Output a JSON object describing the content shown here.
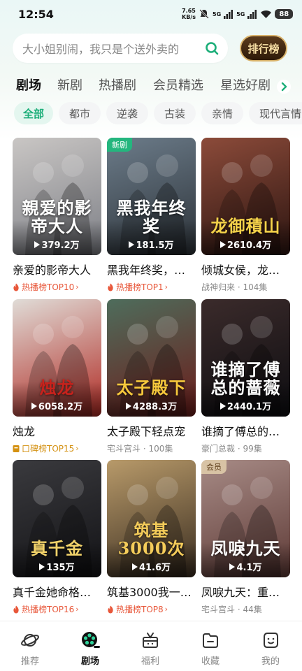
{
  "status_bar": {
    "time": "12:54",
    "speed_value": "7.65",
    "speed_unit": "KB/s",
    "network_1": "5G",
    "network_2": "5G",
    "battery": "88"
  },
  "search": {
    "placeholder": "大小姐别闹，我只是个送外卖的"
  },
  "rank_button": "排行榜",
  "tabs": [
    {
      "label": "剧场",
      "active": true
    },
    {
      "label": "新剧",
      "active": false
    },
    {
      "label": "热播剧",
      "active": false
    },
    {
      "label": "会员精选",
      "active": false
    },
    {
      "label": "星选好剧",
      "active": false
    }
  ],
  "filters": [
    {
      "label": "全部",
      "active": true
    },
    {
      "label": "都市",
      "active": false
    },
    {
      "label": "逆袭",
      "active": false
    },
    {
      "label": "古装",
      "active": false
    },
    {
      "label": "亲情",
      "active": false
    },
    {
      "label": "现代言情",
      "active": false
    }
  ],
  "dramas": [
    {
      "title": "亲爱的影帝大人",
      "views": "379.2万",
      "poster_text": "親爱的影帝大人",
      "sub_type": "rank",
      "sub": "热播榜TOP10",
      "badge": "",
      "colors": [
        "#c9c6c4",
        "#7d7f86"
      ],
      "text_color": "#ffffff"
    },
    {
      "title": "黑我年终奖，…",
      "views": "181.5万",
      "poster_text": "黑我年终奖",
      "sub_type": "rank",
      "sub": "热播榜TOP1",
      "badge": "新剧",
      "colors": [
        "#6c7c8a",
        "#2c3238"
      ],
      "text_color": "#ffffff"
    },
    {
      "title": "倾城女侯，龙…",
      "views": "2610.4万",
      "poster_text": "龙御積山",
      "sub_type": "meta",
      "sub": "战神归来 · 104集",
      "badge": "",
      "colors": [
        "#8c4b3a",
        "#2b1410"
      ],
      "text_color": "#f4d24a"
    },
    {
      "title": "烛龙",
      "views": "6058.2万",
      "poster_text": "烛龙",
      "sub_type": "rank-gold",
      "sub": "口碑榜TOP15",
      "badge": "",
      "colors": [
        "#e0dcd7",
        "#b02a23"
      ],
      "text_color": "#c8221c"
    },
    {
      "title": "太子殿下轻点宠",
      "views": "4288.3万",
      "poster_text": "太子殿下",
      "sub_type": "meta",
      "sub": "宅斗宫斗 · 100集",
      "badge": "",
      "colors": [
        "#4e6d5c",
        "#6b1c1a"
      ],
      "text_color": "#f6c83c"
    },
    {
      "title": "谁摘了傅总的…",
      "views": "2440.1万",
      "poster_text": "谁摘了傅总的蔷薇",
      "sub_type": "meta",
      "sub": "豪门总裁 · 99集",
      "badge": "",
      "colors": [
        "#3b2b2b",
        "#0c0c10"
      ],
      "text_color": "#ffffff"
    },
    {
      "title": "真千金她命格…",
      "views": "135万",
      "poster_text": "真千金",
      "sub_type": "rank",
      "sub": "热播榜TOP16",
      "badge": "",
      "colors": [
        "#3a3a3e",
        "#131316"
      ],
      "text_color": "#f2d36a"
    },
    {
      "title": "筑基3000我一…",
      "views": "41.6万",
      "poster_text": "筑基3000次",
      "sub_type": "rank",
      "sub": "热播榜TOP8",
      "badge": "",
      "colors": [
        "#b89a6a",
        "#3a2d20"
      ],
      "text_color": "#f4cc5a"
    },
    {
      "title": "凤唳九天：重…",
      "views": "4.1万",
      "poster_text": "凤唳九天",
      "sub_type": "meta",
      "sub": "宅斗宫斗 · 44集",
      "badge": "会员",
      "colors": [
        "#a78b86",
        "#5e3a36"
      ],
      "text_color": "#ffffff"
    }
  ],
  "bottom_nav": [
    {
      "label": "推荐",
      "icon": "planet-icon",
      "active": false
    },
    {
      "label": "剧场",
      "icon": "film-reel-icon",
      "active": true
    },
    {
      "label": "福利",
      "icon": "gift-icon",
      "active": false
    },
    {
      "label": "收藏",
      "icon": "folder-icon",
      "active": false
    },
    {
      "label": "我的",
      "icon": "profile-icon",
      "active": false
    }
  ],
  "colors": {
    "accent": "#1cae79",
    "rank": "#e8573a",
    "rank_gold": "#d49112"
  }
}
